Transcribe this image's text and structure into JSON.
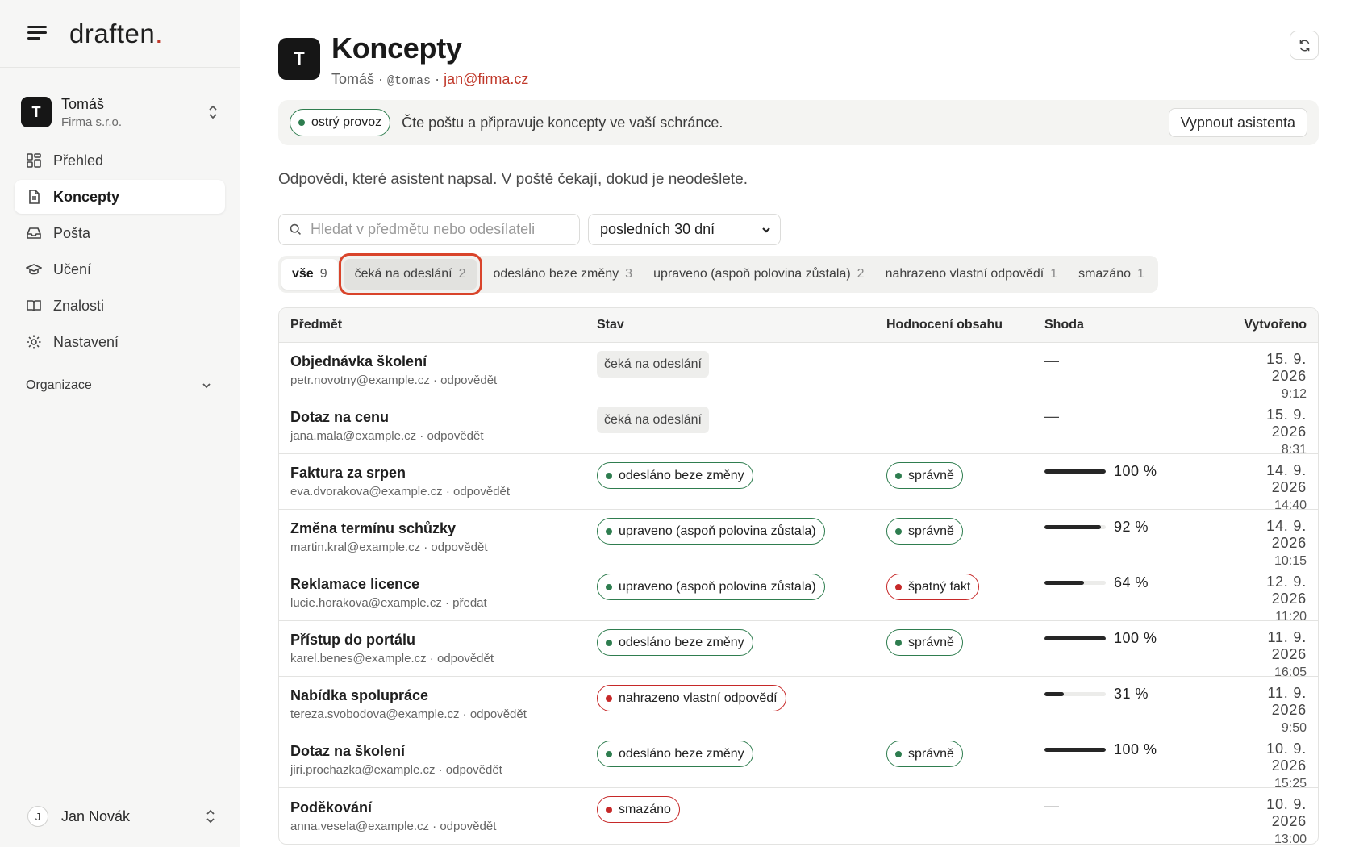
{
  "brand": {
    "logo_text": "draften",
    "logo_dot": "."
  },
  "workspace": {
    "initial": "T",
    "name": "Tomáš",
    "org": "Firma s.r.o."
  },
  "nav": [
    {
      "label": "Přehled",
      "icon": "dashboard-icon"
    },
    {
      "label": "Koncepty",
      "icon": "document-icon",
      "active": true
    },
    {
      "label": "Pošta",
      "icon": "inbox-icon"
    },
    {
      "label": "Učení",
      "icon": "graduation-cap-icon"
    },
    {
      "label": "Znalosti",
      "icon": "book-icon"
    },
    {
      "label": "Nastavení",
      "icon": "gear-icon"
    }
  ],
  "org_section": "Organizace",
  "user": {
    "initial": "J",
    "name": "Jan Novák"
  },
  "header": {
    "initial": "T",
    "title": "Koncepty",
    "name": "Tomáš",
    "sep": "·",
    "handle": "@tomas",
    "email": "jan@firma.cz"
  },
  "banner": {
    "mode": "ostrý provoz",
    "text": "Čte poštu a připravuje koncepty ve vaší schránce.",
    "button": "Vypnout asistenta"
  },
  "description": "Odpovědi, které asistent napsal. V poště čekají, dokud je neodešlete.",
  "search": {
    "placeholder": "Hledat v předmětu nebo odesílateli",
    "value": ""
  },
  "period": {
    "value": "posledních 30 dní"
  },
  "tabs": [
    {
      "label": "vše",
      "count": "9"
    },
    {
      "label": "čeká na odeslání",
      "count": "2"
    },
    {
      "label": "odesláno beze změny",
      "count": "3"
    },
    {
      "label": "upraveno (aspoň polovina zůstala)",
      "count": "2"
    },
    {
      "label": "nahrazeno vlastní odpovědí",
      "count": "1"
    },
    {
      "label": "smazáno",
      "count": "1"
    }
  ],
  "columns": {
    "subject": "Předmět",
    "status": "Stav",
    "rating": "Hodnocení obsahu",
    "match": "Shoda",
    "created": "Vytvořeno"
  },
  "rows": [
    {
      "subject": "Objednávka školení",
      "sender": "petr.novotny@example.cz · odpovědět",
      "status": "čeká na odeslání",
      "status_type": "grey",
      "rating": "",
      "rating_type": "",
      "match": null,
      "match_text": "—",
      "date": "15. 9. 2026",
      "time": "9:12"
    },
    {
      "subject": "Dotaz na cenu",
      "sender": "jana.mala@example.cz · odpovědět",
      "status": "čeká na odeslání",
      "status_type": "grey",
      "rating": "",
      "rating_type": "",
      "match": null,
      "match_text": "—",
      "date": "15. 9. 2026",
      "time": "8:31"
    },
    {
      "subject": "Faktura za srpen",
      "sender": "eva.dvorakova@example.cz · odpovědět",
      "status": "odesláno beze změny",
      "status_type": "green",
      "rating": "správně",
      "rating_type": "green",
      "match": 100,
      "match_text": "100 %",
      "date": "14. 9. 2026",
      "time": "14:40"
    },
    {
      "subject": "Změna termínu schůzky",
      "sender": "martin.kral@example.cz · odpovědět",
      "status": "upraveno (aspoň polovina zůstala)",
      "status_type": "green",
      "rating": "správně",
      "rating_type": "green",
      "match": 92,
      "match_text": "92 %",
      "date": "14. 9. 2026",
      "time": "10:15"
    },
    {
      "subject": "Reklamace licence",
      "sender": "lucie.horakova@example.cz · předat",
      "status": "upraveno (aspoň polovina zůstala)",
      "status_type": "green",
      "rating": "špatný fakt",
      "rating_type": "red",
      "match": 64,
      "match_text": "64 %",
      "date": "12. 9. 2026",
      "time": "11:20"
    },
    {
      "subject": "Přístup do portálu",
      "sender": "karel.benes@example.cz · odpovědět",
      "status": "odesláno beze změny",
      "status_type": "green",
      "rating": "správně",
      "rating_type": "green",
      "match": 100,
      "match_text": "100 %",
      "date": "11. 9. 2026",
      "time": "16:05"
    },
    {
      "subject": "Nabídka spolupráce",
      "sender": "tereza.svobodova@example.cz · odpovědět",
      "status": "nahrazeno vlastní odpovědí",
      "status_type": "red",
      "rating": "",
      "rating_type": "",
      "match": 31,
      "match_text": "31 %",
      "date": "11. 9. 2026",
      "time": "9:50"
    },
    {
      "subject": "Dotaz na školení",
      "sender": "jiri.prochazka@example.cz · odpovědět",
      "status": "odesláno beze změny",
      "status_type": "green",
      "rating": "správně",
      "rating_type": "green",
      "match": 100,
      "match_text": "100 %",
      "date": "10. 9. 2026",
      "time": "15:25"
    },
    {
      "subject": "Poděkování",
      "sender": "anna.vesela@example.cz · odpovědět",
      "status": "smazáno",
      "status_type": "red",
      "rating": "",
      "rating_type": "",
      "match": null,
      "match_text": "—",
      "date": "10. 9. 2026",
      "time": "13:00"
    }
  ],
  "colors": {
    "accent": "#c0392b",
    "green": "#2e7d4f",
    "red": "#c62828",
    "highlight": "#d9442b"
  }
}
